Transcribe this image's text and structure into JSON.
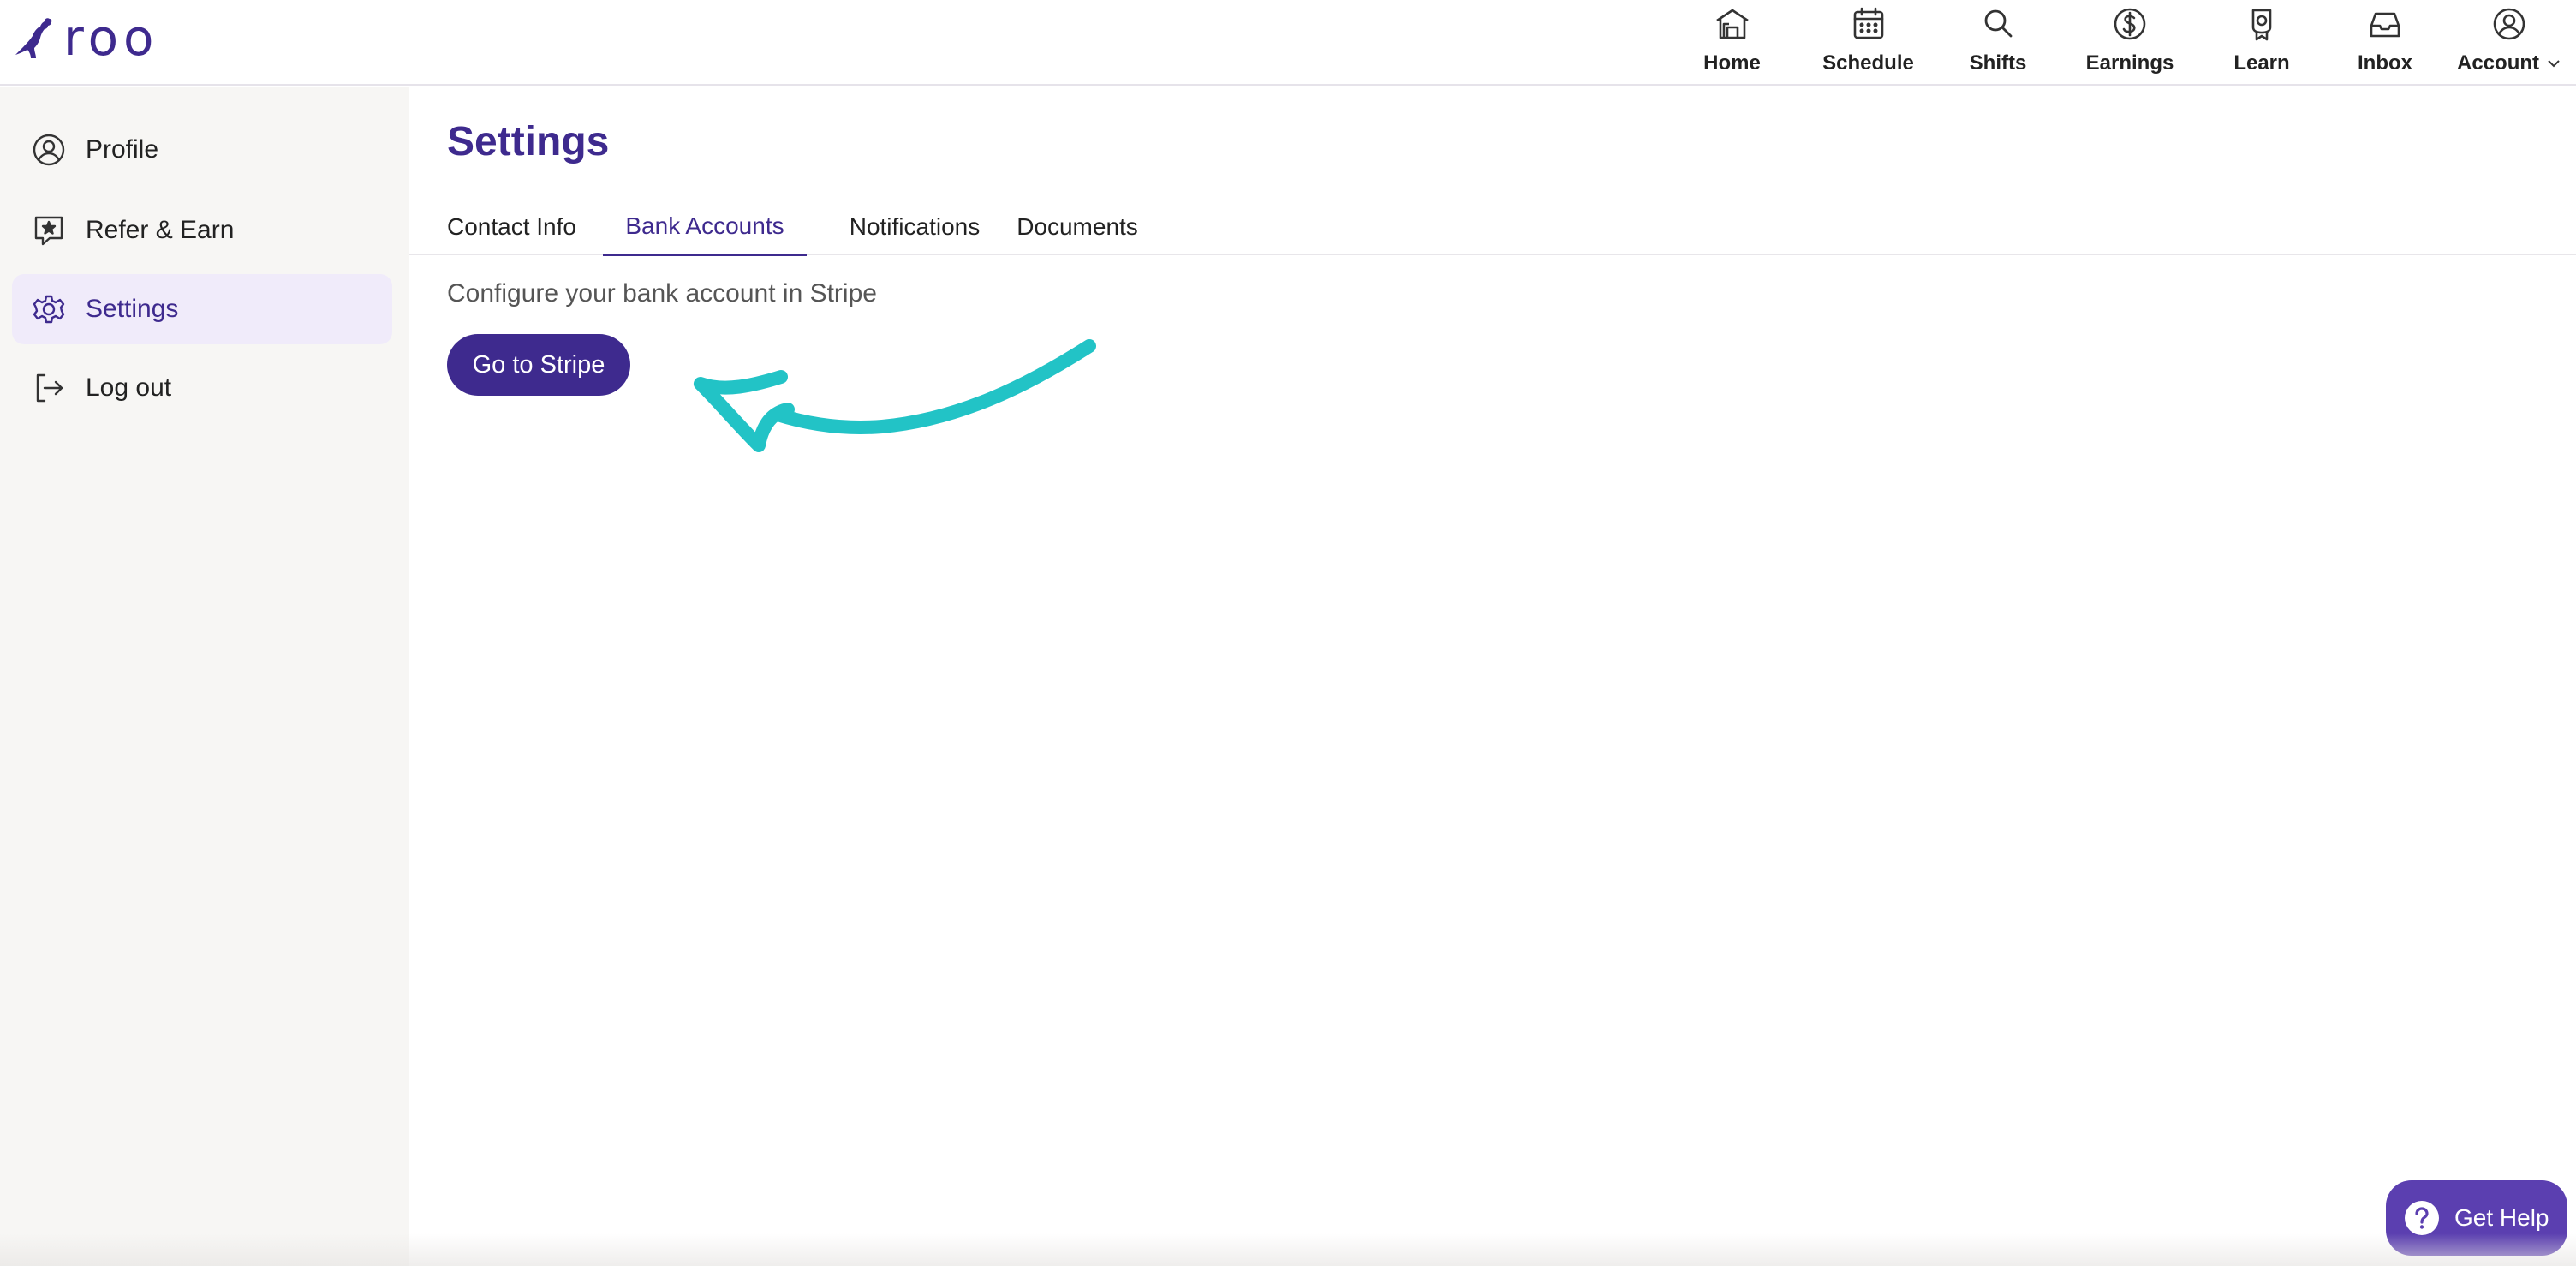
{
  "app": {
    "logo_text": "roo"
  },
  "nav": {
    "home": "Home",
    "schedule": "Schedule",
    "shifts": "Shifts",
    "earnings": "Earnings",
    "learn": "Learn",
    "inbox": "Inbox",
    "account": "Account"
  },
  "sidebar": {
    "items": [
      {
        "label": "Profile",
        "icon": "user-circle-icon"
      },
      {
        "label": "Refer & Earn",
        "icon": "star-message-icon"
      },
      {
        "label": "Settings",
        "icon": "gear-icon",
        "active": true
      },
      {
        "label": "Log out",
        "icon": "logout-icon"
      }
    ]
  },
  "main": {
    "title": "Settings",
    "tabs": [
      {
        "label": "Contact Info"
      },
      {
        "label": "Bank Accounts",
        "active": true
      },
      {
        "label": "Notifications"
      },
      {
        "label": "Documents"
      }
    ],
    "description": "Configure your bank account in Stripe",
    "button_label": "Go to Stripe"
  },
  "help": {
    "label": "Get Help"
  },
  "colors": {
    "brand": "#3e2a8e",
    "help_bg": "#5b3fb0",
    "arrow": "#22c3c6",
    "sidebar_bg": "#f7f6f4",
    "active_item_bg": "#f0ebfa"
  }
}
